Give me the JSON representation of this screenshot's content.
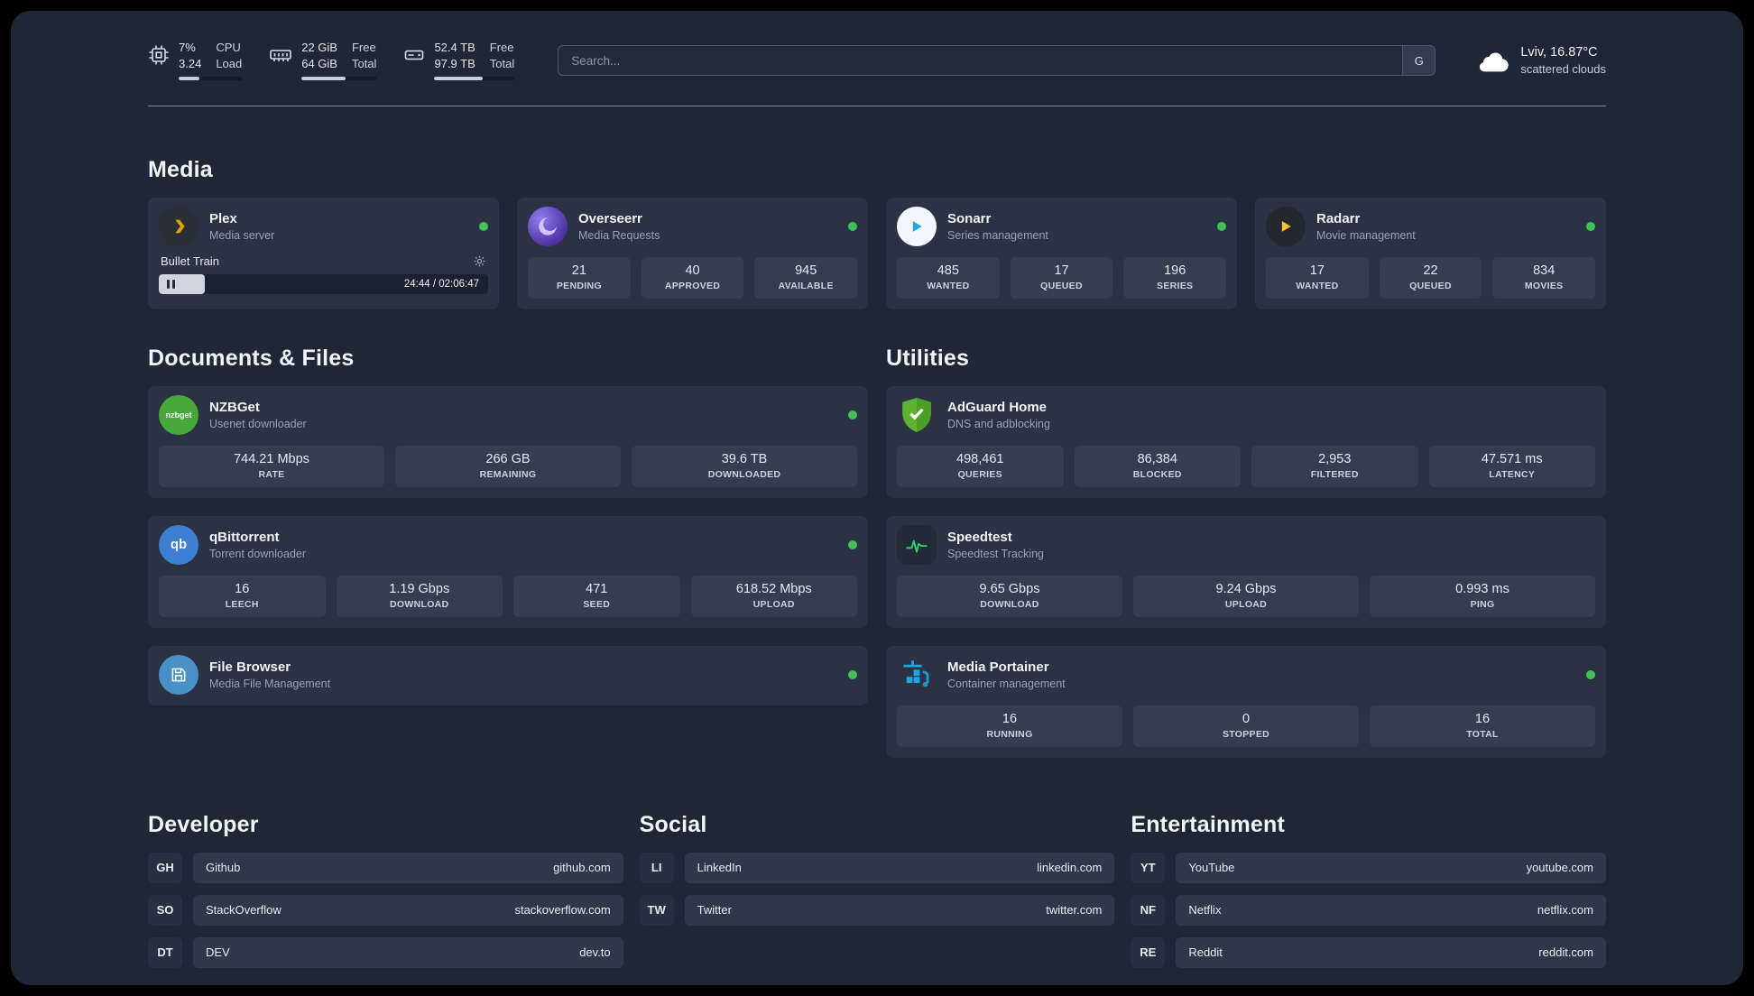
{
  "colors": {
    "status_online": "#40c057",
    "accent_plex": "#e5a00d",
    "accent_sonarr": "#1ea7e0",
    "accent_radarr": "#ffc233",
    "accent_adguard": "#5eb133",
    "accent_portainer": "#18a9e4",
    "page_background": "#1f2636",
    "card_background": "#2a3243"
  },
  "topbar": {
    "cpu": {
      "value_top": "7%",
      "value_bottom": "3.24",
      "label_top": "CPU",
      "label_bottom": "Load",
      "progress": 33
    },
    "memory": {
      "value_top": "22 GiB",
      "value_bottom": "64 GiB",
      "label_top": "Free",
      "label_bottom": "Total",
      "progress": 58
    },
    "disk": {
      "value_top": "52.4 TB",
      "value_bottom": "97.9 TB",
      "label_top": "Free",
      "label_bottom": "Total",
      "progress": 60
    },
    "search": {
      "placeholder": "Search...",
      "button": "G"
    },
    "weather": {
      "location": "Lviv, 16.87°C",
      "condition": "scattered clouds"
    }
  },
  "media": {
    "title": "Media",
    "plex": {
      "name": "Plex",
      "subtitle": "Media server",
      "track": "Bullet Train",
      "time": "24:44 / 02:06:47",
      "progress": 14
    },
    "overseerr": {
      "name": "Overseerr",
      "subtitle": "Media Requests",
      "stats": [
        {
          "value": "21",
          "label": "PENDING"
        },
        {
          "value": "40",
          "label": "APPROVED"
        },
        {
          "value": "945",
          "label": "AVAILABLE"
        }
      ]
    },
    "sonarr": {
      "name": "Sonarr",
      "subtitle": "Series management",
      "stats": [
        {
          "value": "485",
          "label": "WANTED"
        },
        {
          "value": "17",
          "label": "QUEUED"
        },
        {
          "value": "196",
          "label": "SERIES"
        }
      ]
    },
    "radarr": {
      "name": "Radarr",
      "subtitle": "Movie management",
      "stats": [
        {
          "value": "17",
          "label": "WANTED"
        },
        {
          "value": "22",
          "label": "QUEUED"
        },
        {
          "value": "834",
          "label": "MOVIES"
        }
      ]
    }
  },
  "documents": {
    "title": "Documents & Files",
    "nzbget": {
      "name": "NZBGet",
      "subtitle": "Usenet downloader",
      "icon_text": "nzbget",
      "stats": [
        {
          "value": "744.21 Mbps",
          "label": "RATE"
        },
        {
          "value": "266 GB",
          "label": "REMAINING"
        },
        {
          "value": "39.6 TB",
          "label": "DOWNLOADED"
        }
      ]
    },
    "qbittorrent": {
      "name": "qBittorrent",
      "subtitle": "Torrent downloader",
      "icon_text": "qb",
      "stats": [
        {
          "value": "16",
          "label": "LEECH"
        },
        {
          "value": "1.19 Gbps",
          "label": "DOWNLOAD"
        },
        {
          "value": "471",
          "label": "SEED"
        },
        {
          "value": "618.52 Mbps",
          "label": "UPLOAD"
        }
      ]
    },
    "filebrowser": {
      "name": "File Browser",
      "subtitle": "Media File Management"
    }
  },
  "utilities": {
    "title": "Utilities",
    "adguard": {
      "name": "AdGuard Home",
      "subtitle": "DNS and adblocking",
      "stats": [
        {
          "value": "498,461",
          "label": "QUERIES"
        },
        {
          "value": "86,384",
          "label": "BLOCKED"
        },
        {
          "value": "2,953",
          "label": "FILTERED"
        },
        {
          "value": "47.571 ms",
          "label": "LATENCY"
        }
      ]
    },
    "speedtest": {
      "name": "Speedtest",
      "subtitle": "Speedtest Tracking",
      "stats": [
        {
          "value": "9.65 Gbps",
          "label": "DOWNLOAD"
        },
        {
          "value": "9.24 Gbps",
          "label": "UPLOAD"
        },
        {
          "value": "0.993 ms",
          "label": "PING"
        }
      ]
    },
    "portainer": {
      "name": "Media Portainer",
      "subtitle": "Container management",
      "stats": [
        {
          "value": "16",
          "label": "RUNNING"
        },
        {
          "value": "0",
          "label": "STOPPED"
        },
        {
          "value": "16",
          "label": "TOTAL"
        }
      ]
    }
  },
  "links": {
    "developer": {
      "title": "Developer",
      "items": [
        {
          "badge": "GH",
          "name": "Github",
          "url": "github.com"
        },
        {
          "badge": "SO",
          "name": "StackOverflow",
          "url": "stackoverflow.com"
        },
        {
          "badge": "DT",
          "name": "DEV",
          "url": "dev.to"
        }
      ]
    },
    "social": {
      "title": "Social",
      "items": [
        {
          "badge": "LI",
          "name": "LinkedIn",
          "url": "linkedin.com"
        },
        {
          "badge": "TW",
          "name": "Twitter",
          "url": "twitter.com"
        }
      ]
    },
    "entertainment": {
      "title": "Entertainment",
      "items": [
        {
          "badge": "YT",
          "name": "YouTube",
          "url": "youtube.com"
        },
        {
          "badge": "NF",
          "name": "Netflix",
          "url": "netflix.com"
        },
        {
          "badge": "RE",
          "name": "Reddit",
          "url": "reddit.com"
        }
      ]
    }
  }
}
